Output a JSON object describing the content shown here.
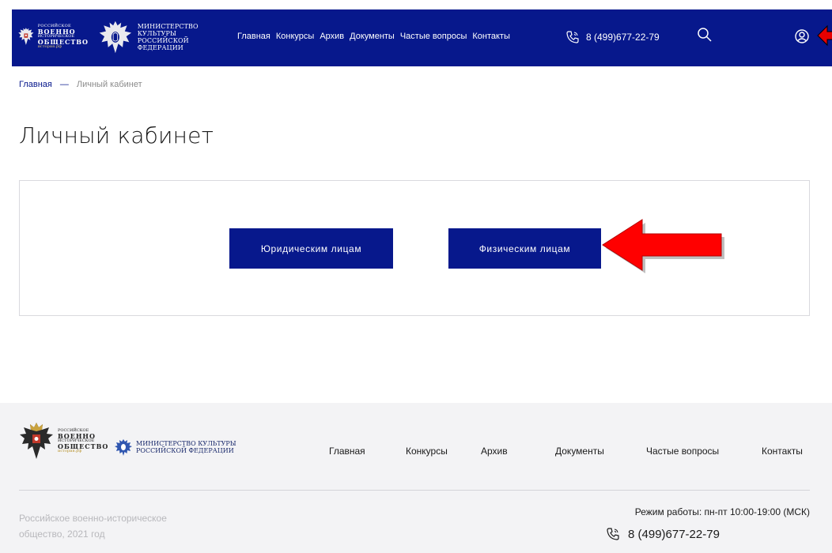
{
  "header": {
    "logo_rvio": {
      "line1": "РОССИЙСКОЕ",
      "line2": "ВОЕННО",
      "line3": "ИСТОРИЧЕСКОЕ",
      "line4": "ОБЩЕСТВО",
      "line5": "история.рф"
    },
    "logo_mk": {
      "line1": "МИНИСТЕРСТВО КУЛЬТУРЫ",
      "line2": "РОССИЙСКОЙ ФЕДЕРАЦИИ"
    },
    "nav": [
      "Главная",
      "Конкурсы",
      "Архив",
      "Документы",
      "Частые вопросы",
      "Контакты"
    ],
    "phone": "8 (499)677-22-79",
    "icons": {
      "phone": "phone-icon",
      "search": "search-icon",
      "user": "user-icon"
    },
    "brand_color": "#07188c"
  },
  "breadcrumb": {
    "home": "Главная",
    "separator": "—",
    "current": "Личный кабинет"
  },
  "page_title": "Личный кабинет",
  "card": {
    "btn_legal": "Юридическим лицам",
    "btn_phys": "Физическим лицам"
  },
  "annotations": {
    "arrow_color": "#e60000"
  },
  "footer": {
    "logo_rvio": {
      "line1": "РОССИЙСКОЕ",
      "line2": "ВОЕННО",
      "line3": "ИСТОРИЧЕСКОЕ",
      "line4": "ОБЩЕСТВО",
      "line5": "история.рф"
    },
    "logo_mk": {
      "line1": "МИНИСТЕРСТВО КУЛЬТУРЫ",
      "line2": "РОССИЙСКОЙ ФЕДЕРАЦИИ"
    },
    "nav": [
      "Главная",
      "Конкурсы",
      "Архив",
      "Документы",
      "Частые вопросы",
      "Контакты"
    ],
    "copyright_line1": "Российское военно-историческое",
    "copyright_line2": "общество, 2021 год",
    "hours": "Режим работы: пн-пт 10:00-19:00 (МСК)",
    "phone": "8 (499)677-22-79"
  }
}
